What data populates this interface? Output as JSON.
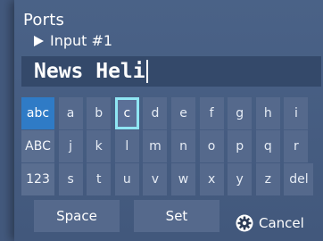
{
  "header": {
    "title": "Ports",
    "breadcrumb": "Input #1"
  },
  "entry": {
    "value": "News Heli"
  },
  "keyboard": {
    "rows": [
      {
        "mode": "abc",
        "active": true,
        "keys": [
          "a",
          "b",
          "c",
          "d",
          "e",
          "f",
          "g",
          "h",
          "i"
        ]
      },
      {
        "mode": "ABC",
        "active": false,
        "keys": [
          "j",
          "k",
          "l",
          "m",
          "n",
          "o",
          "p",
          "q",
          "r"
        ]
      },
      {
        "mode": "123",
        "active": false,
        "keys": [
          "s",
          "t",
          "u",
          "v",
          "w",
          "x",
          "y",
          "z",
          "del"
        ]
      }
    ],
    "selected_key": "c"
  },
  "buttons": {
    "space": "Space",
    "set": "Set",
    "cancel": "Cancel"
  },
  "colors": {
    "active_mode": "#2f7bc6",
    "selection_outline": "#8fe6f4",
    "key_bg": "#55698c"
  },
  "icons": {
    "cancel": "gear-icon",
    "breadcrumb": "play-arrow-icon"
  }
}
